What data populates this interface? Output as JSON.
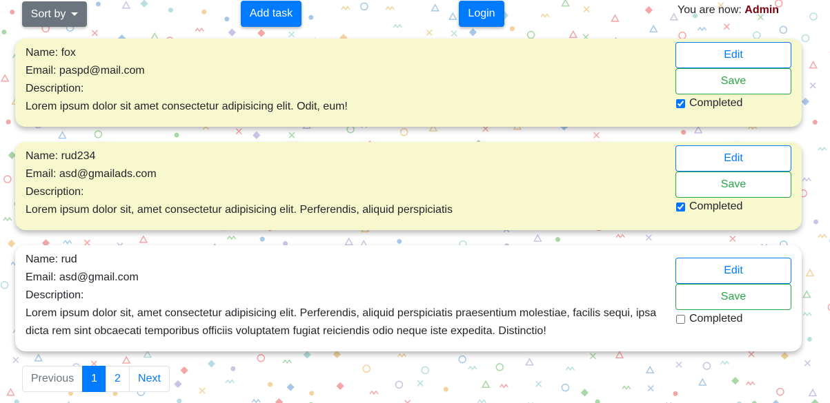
{
  "toolbar": {
    "sort_label": "Sort by",
    "add_task_label": "Add task",
    "login_label": "Login",
    "status_prefix": "You are now:",
    "status_user": "Admin"
  },
  "tasks": [
    {
      "name_text": "Name: fox",
      "email_text": "Email: paspd@mail.com",
      "description_label": "Description:",
      "description": "Lorem ipsum dolor sit amet consectetur adipisicing elit. Odit, eum!",
      "completed": true
    },
    {
      "name_text": "Name: rud234",
      "email_text": "Email: asd@gmailads.com",
      "description_label": "Description:",
      "description": "Lorem ipsum dolor sit, amet consectetur adipisicing elit. Perferendis, aliquid perspiciatis",
      "completed": true
    },
    {
      "name_text": "Name: rud",
      "email_text": "Email: asd@gmail.com",
      "description_label": "Description:",
      "description": "Lorem ipsum dolor sit, amet consectetur adipisicing elit. Perferendis, aliquid perspiciatis praesentium molestiae, facilis sequi, ipsa dicta rem sint obcaecati temporibus officiis voluptatem fugiat reiciendis odio neque iste expedita. Distinctio!",
      "completed": false
    }
  ],
  "card_actions": {
    "edit_label": "Edit",
    "save_label": "Save",
    "completed_label": "Completed"
  },
  "pagination": {
    "previous_label": "Previous",
    "pages": [
      "1",
      "2"
    ],
    "current_page": "1",
    "next_label": "Next"
  },
  "colors": {
    "primary": "#007bff",
    "success": "#28a745",
    "secondary": "#6c757d",
    "completed_card": "#f7f8cd",
    "admin_text": "#7a0010"
  }
}
